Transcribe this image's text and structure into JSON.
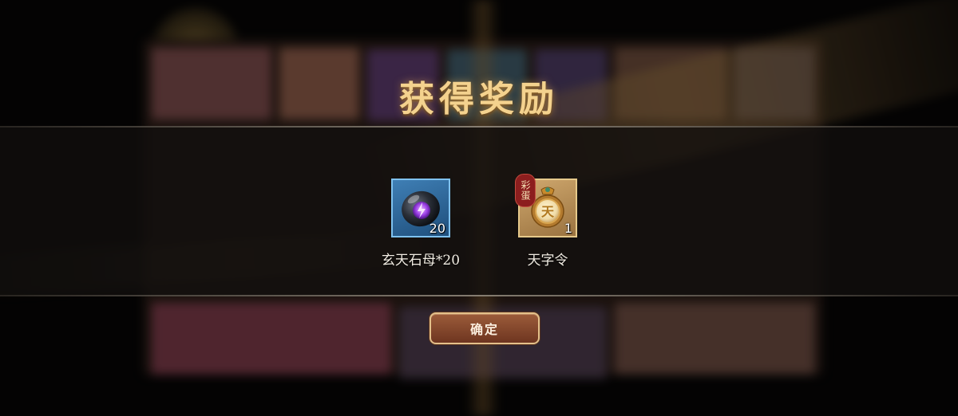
{
  "dialog": {
    "title": "获得奖励",
    "confirm_label": "确定"
  },
  "rewards": [
    {
      "name": "玄天石母*20",
      "quantity": "20",
      "frame_color": "#3f7fb5",
      "icon": "dark-stone-lightning-icon"
    },
    {
      "name": "天字令",
      "quantity": "1",
      "frame_color": "#cfa86e",
      "icon": "tian-medallion-icon",
      "tag": "彩蛋"
    }
  ],
  "colors": {
    "title": "#f4d28e",
    "button": "#8a4a2c"
  }
}
